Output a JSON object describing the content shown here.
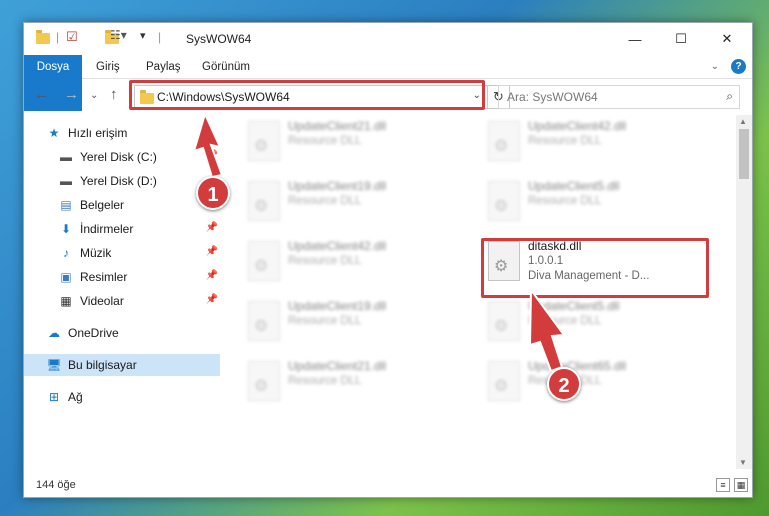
{
  "window": {
    "title": "SysWOW64"
  },
  "ribbon": {
    "tabs": [
      "Dosya",
      "Giriş",
      "Paylaş",
      "Görünüm"
    ]
  },
  "address": {
    "path": "C:\\Windows\\SysWOW64"
  },
  "search": {
    "placeholder": "Ara: SysWOW64"
  },
  "sidebar": {
    "items": [
      {
        "label": "Hızlı erişim",
        "icon": "star-icon"
      },
      {
        "label": "Yerel Disk (C:)",
        "icon": "drive-icon"
      },
      {
        "label": "Yerel Disk (D:)",
        "icon": "drive-icon"
      },
      {
        "label": "Belgeler",
        "icon": "documents-icon"
      },
      {
        "label": "İndirmeler",
        "icon": "download-icon"
      },
      {
        "label": "Müzik",
        "icon": "music-icon"
      },
      {
        "label": "Resimler",
        "icon": "pictures-icon"
      },
      {
        "label": "Videolar",
        "icon": "video-icon"
      },
      {
        "label": "OneDrive",
        "icon": "cloud-icon"
      },
      {
        "label": "Bu bilgisayar",
        "icon": "computer-icon"
      },
      {
        "label": "Ağ",
        "icon": "network-icon"
      }
    ]
  },
  "files": [
    {
      "name": "UpdateClient21.dll",
      "line2": "Resource DLL",
      "line3": ""
    },
    {
      "name": "UpdateClient42.dll",
      "line2": "Resource DLL",
      "line3": ""
    },
    {
      "name": "UpdateClient19.dll",
      "line2": "Resource DLL",
      "line3": ""
    },
    {
      "name": "UpdateClient5.dll",
      "line2": "Resource DLL",
      "line3": ""
    },
    {
      "name": "UpdateClient42.dll",
      "line2": "Resource DLL",
      "line3": ""
    },
    {
      "name": "ditaskd.dll",
      "line2": "1.0.0.1",
      "line3": "Diva Management - D..."
    },
    {
      "name": "UpdateClient19.dll",
      "line2": "Resource DLL",
      "line3": ""
    },
    {
      "name": "UpdateClient5.dll",
      "line2": "Resource DLL",
      "line3": ""
    },
    {
      "name": "UpdateClient21.dll",
      "line2": "Resource DLL",
      "line3": ""
    },
    {
      "name": "UpdateClient65.dll",
      "line2": "Resource DLL",
      "line3": ""
    }
  ],
  "status": {
    "count": "144 öğe"
  },
  "callouts": {
    "one": "1",
    "two": "2"
  },
  "colors": {
    "accent": "#1979ca",
    "highlight": "#d33c3c",
    "selected": "#cce4f7"
  }
}
